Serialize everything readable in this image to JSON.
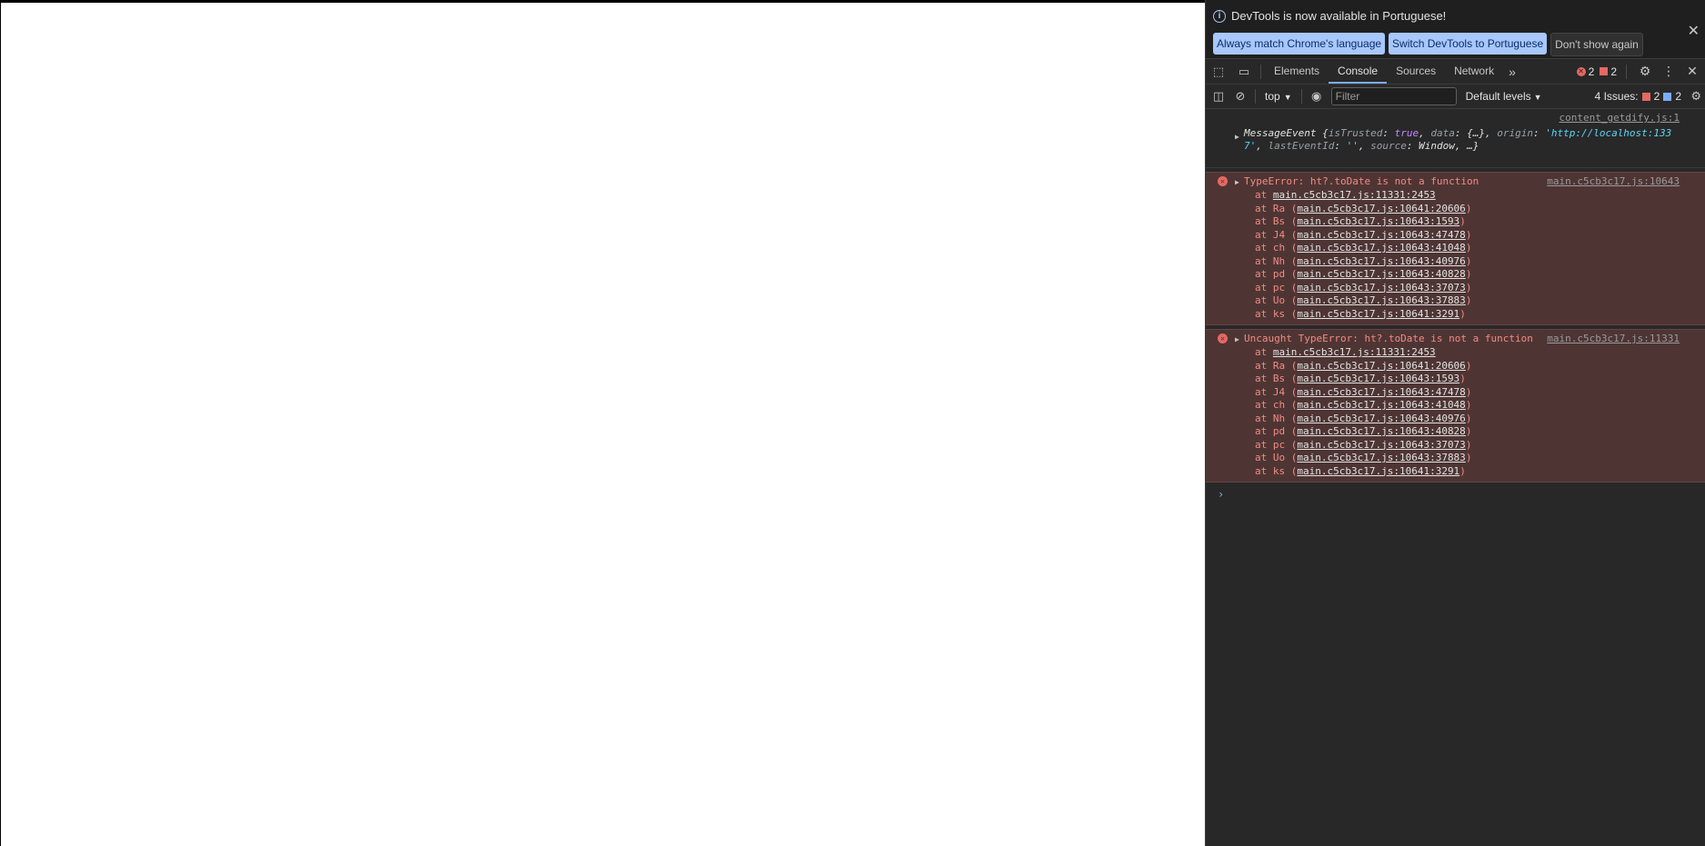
{
  "infobar": {
    "message": "DevTools is now available in Portuguese!",
    "buttons": [
      "Always match Chrome's language",
      "Switch DevTools to Portuguese",
      "Don't show again"
    ]
  },
  "tabs": [
    "Elements",
    "Console",
    "Sources",
    "Network"
  ],
  "active_tab": "Console",
  "counts": {
    "errors": "2",
    "warnings": "2"
  },
  "console_toolbar": {
    "context": "top",
    "filter_placeholder": "Filter",
    "levels": "Default levels",
    "issues_label": "4 Issues:",
    "issues_errors": "2",
    "issues_info": "2"
  },
  "messages": {
    "log": {
      "source": "content_getdify.js:1",
      "line1": {
        "name": "MessageEvent",
        "open": " {",
        "k1": "isTrusted",
        "v1": "true",
        "k2": "data",
        "v2": "{…}",
        "k3": "origin",
        "v3": "'http://localhost:133"
      },
      "line2": {
        "v3b": "7'",
        "k4": "lastEventId",
        "v4": "''",
        "k5": "source",
        "v5": "Window",
        "tail": ", …}"
      }
    },
    "errors": [
      {
        "head": "TypeError: ht?.toDate is not a function",
        "source": "main.c5cb3c17.js:10643",
        "stack": [
          {
            "fn": "",
            "loc": "main.c5cb3c17.js:11331:2453"
          },
          {
            "fn": "Ra",
            "loc": "main.c5cb3c17.js:10641:20606"
          },
          {
            "fn": "Bs",
            "loc": "main.c5cb3c17.js:10643:1593"
          },
          {
            "fn": "J4",
            "loc": "main.c5cb3c17.js:10643:47478"
          },
          {
            "fn": "ch",
            "loc": "main.c5cb3c17.js:10643:41048"
          },
          {
            "fn": "Nh",
            "loc": "main.c5cb3c17.js:10643:40976"
          },
          {
            "fn": "pd",
            "loc": "main.c5cb3c17.js:10643:40828"
          },
          {
            "fn": "pc",
            "loc": "main.c5cb3c17.js:10643:37073"
          },
          {
            "fn": "Uo",
            "loc": "main.c5cb3c17.js:10643:37883"
          },
          {
            "fn": "ks",
            "loc": "main.c5cb3c17.js:10641:3291"
          }
        ]
      },
      {
        "head": "Uncaught TypeError: ht?.toDate is not a function",
        "source": "main.c5cb3c17.js:11331",
        "stack": [
          {
            "fn": "",
            "loc": "main.c5cb3c17.js:11331:2453"
          },
          {
            "fn": "Ra",
            "loc": "main.c5cb3c17.js:10641:20606"
          },
          {
            "fn": "Bs",
            "loc": "main.c5cb3c17.js:10643:1593"
          },
          {
            "fn": "J4",
            "loc": "main.c5cb3c17.js:10643:47478"
          },
          {
            "fn": "ch",
            "loc": "main.c5cb3c17.js:10643:41048"
          },
          {
            "fn": "Nh",
            "loc": "main.c5cb3c17.js:10643:40976"
          },
          {
            "fn": "pd",
            "loc": "main.c5cb3c17.js:10643:40828"
          },
          {
            "fn": "pc",
            "loc": "main.c5cb3c17.js:10643:37073"
          },
          {
            "fn": "Uo",
            "loc": "main.c5cb3c17.js:10643:37883"
          },
          {
            "fn": "ks",
            "loc": "main.c5cb3c17.js:10641:3291"
          }
        ]
      }
    ]
  },
  "colors": {
    "error_bg": "#4e3534",
    "error_text": "#f28b82",
    "accent": "#7cacf8",
    "panel_bg": "#282828"
  }
}
